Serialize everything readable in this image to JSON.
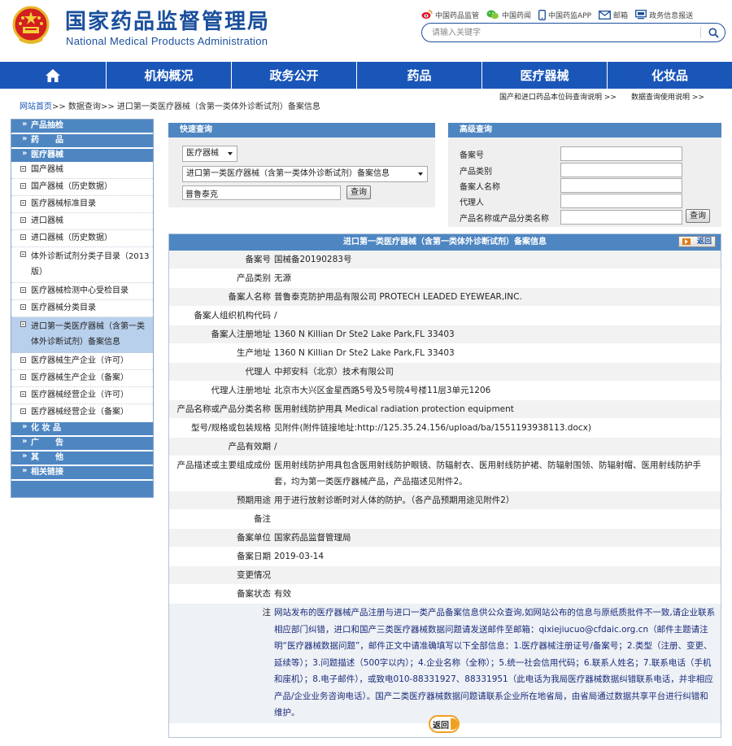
{
  "header": {
    "logo_cn": "国家药品监督管理局",
    "logo_en": "National Medical Products Administration",
    "top_links": [
      {
        "icon": "weibo-icon",
        "label": "中国药品监管"
      },
      {
        "icon": "wechat-icon",
        "label": "中国药闻"
      },
      {
        "icon": "mobile-icon",
        "label": "中国药监APP"
      },
      {
        "icon": "mail-icon",
        "label": "邮箱"
      },
      {
        "icon": "monitor-icon",
        "label": "政务信息报送"
      }
    ],
    "search_placeholder": "请输入关键字",
    "brand_color": "#1a4f9c"
  },
  "nav": {
    "home_icon": "home-icon",
    "items": [
      "机构概况",
      "政务公开",
      "药品",
      "医疗器械",
      "化妆品"
    ],
    "bar_color": "#1a56b8"
  },
  "breadcrumb": {
    "home": "网站首页",
    "rest": ">> 数据查询>> 进口第一类医疗器械（含第一类体外诊断试剂）备案信息"
  },
  "help_links": [
    "国产和进口药品本位码查询说明 >>",
    "数据查询使用说明 >>"
  ],
  "sidebar": {
    "cat_pre": "产品抽检",
    "cat_drug": "药　　品",
    "cat_device": "医疗器械",
    "items": [
      "国产器械",
      "国产器械（历史数据）",
      "医疗器械标准目录",
      "进口器械",
      "进口器械（历史数据）",
      "体外诊断试剂分类子目录（2013版）",
      "医疗器械检测中心受检目录",
      "医疗器械分类目录",
      "进口第一类医疗器械（含第一类体外诊断试剂）备案信息",
      "医疗器械生产企业（许可）",
      "医疗器械生产企业（备案）",
      "医疗器械经营企业（许可）",
      "医疗器械经营企业（备案）"
    ],
    "active_index": 8,
    "cat_cosmetics": "化 妆 品",
    "cat_ads": "广　　告",
    "cat_other": "其　　他",
    "cat_links": "相关链接"
  },
  "quick_query": {
    "title": "快速查询",
    "select1": "医疗器械",
    "select2": "进口第一类医疗器械（含第一类体外诊断试剂）备案信息",
    "keyword": "普鲁泰克",
    "button": "查询"
  },
  "advanced_query": {
    "title": "高级查询",
    "labels": [
      "备案号",
      "产品类别",
      "备案人名称",
      "代理人",
      "产品名称或产品分类名称"
    ],
    "button": "查询"
  },
  "detail": {
    "title": "进口第一类医疗器械（含第一类体外诊断试剂）备案信息",
    "back_label": "返回",
    "rows": [
      {
        "label": "备案号",
        "value": "国械备20190283号"
      },
      {
        "label": "产品类别",
        "value": "无源"
      },
      {
        "label": "备案人名称",
        "value": "普鲁泰克防护用品有限公司 PROTECH LEADED EYEWEAR,INC."
      },
      {
        "label": "备案人组织机构代码",
        "value": "/"
      },
      {
        "label": "备案人注册地址",
        "value": "1360 N Killian Dr Ste2 Lake Park,FL 33403"
      },
      {
        "label": "生产地址",
        "value": "1360 N Killian Dr Ste2 Lake Park,FL 33403"
      },
      {
        "label": "代理人",
        "value": "中邦安科（北京）技术有限公司"
      },
      {
        "label": "代理人注册地址",
        "value": "北京市大兴区金星西路5号及5号院4号楼11层3单元1206"
      },
      {
        "label": "产品名称或产品分类名称",
        "value": "医用射线防护用具 Medical radiation protection equipment"
      },
      {
        "label": "型号/规格或包装规格",
        "value": "见附件(附件链接地址:http://125.35.24.156/upload/ba/1551193938113.docx)"
      },
      {
        "label": "产品有效期",
        "value": "/"
      },
      {
        "label": "产品描述或主要组成成份",
        "value": "医用射线防护用具包含医用射线防护眼镜、防辐射衣、医用射线防护裙、防辐射围领、防辐射帽、医用射线防护手套，均为第一类医疗器械产品，产品描述见附件2。"
      },
      {
        "label": "预期用途",
        "value": "用于进行放射诊断时对人体的防护。（各产品预期用途见附件2）"
      },
      {
        "label": "备注",
        "value": ""
      },
      {
        "label": "备案单位",
        "value": "国家药品监督管理局"
      },
      {
        "label": "备案日期",
        "value": "2019-03-14"
      },
      {
        "label": "变更情况",
        "value": ""
      },
      {
        "label": "备案状态",
        "value": "有效"
      }
    ],
    "note_label": "注",
    "note": "网站发布的医疗器械产品注册与进口一类产品备案信息供公众查询,如网站公布的信息与原纸质批件不一致,请企业联系相应部门纠错，进口和国产三类医疗器械数据问题请发送邮件至邮箱：qixiejiucuo@cfdaic.org.cn（邮件主题请注明“医疗器械数据问题”，邮件正文中请准确填写以下全部信息：1.医疗器械注册证号/备案号；2.类型（注册、变更、延续等）；3.问题描述（500字以内）；4.企业名称（全称）；5.统一社会信用代码；6.联系人姓名；7.联系电话（手机和座机）；8.电子邮件），或致电010-88331927、88331951（此电话为我局医疗器械数据纠错联系电话，并非相应产品/企业业务咨询电话）。国产二类医疗器械数据问题请联系企业所在地省局，由省局通过数据共享平台进行纠错和维护。"
  },
  "back_bottom": "返回"
}
